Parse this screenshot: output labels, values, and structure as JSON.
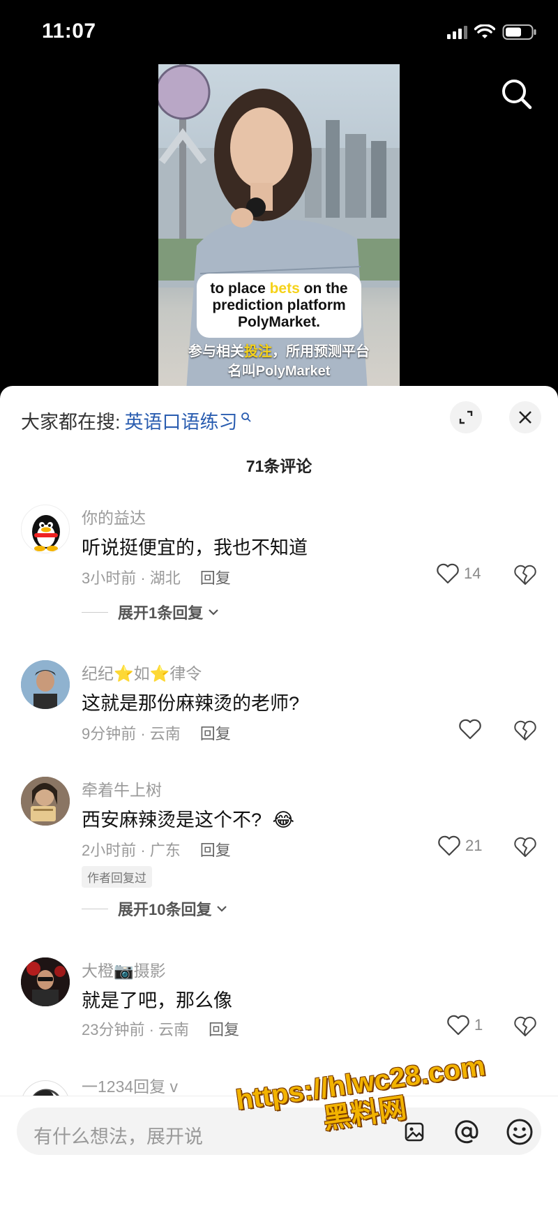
{
  "status_bar": {
    "time": "11:07"
  },
  "video": {
    "subtitle_en_pre": "to place ",
    "subtitle_en_hl": "bets",
    "subtitle_en_post": " on the prediction platform PolyMarket.",
    "subtitle_zh_pre": "参与相关",
    "subtitle_zh_hl": "投注",
    "subtitle_zh_post": "，所用预测平台",
    "subtitle_zh_line2": "名叫PolyMarket"
  },
  "panel": {
    "hot_search_label": "大家都在搜:",
    "hot_search_keyword": "英语口语练习",
    "comment_count": "71条评论"
  },
  "comments": [
    {
      "name": "你的益达",
      "text": "听说挺便宜的，我也不知道",
      "time_location": "3小时前 · 湖北",
      "reply": "回复",
      "likes": "14",
      "expand": "展开1条回复"
    },
    {
      "name": "纪纪⭐如⭐律令",
      "text": "这就是那份麻辣烫的老师?",
      "time_location": "9分钟前 · 云南",
      "reply": "回复",
      "likes": ""
    },
    {
      "name": "牵着牛上树",
      "text": "西安麻辣烫是这个不?",
      "emoji": "😂",
      "time_location": "2小时前 · 广东",
      "reply": "回复",
      "likes": "21",
      "author_tag": "作者回复过",
      "expand": "展开10条回复"
    },
    {
      "name": "大橙📷摄影",
      "text": "就是了吧，那么像",
      "time_location": "23分钟前 · 云南",
      "reply": "回复",
      "likes": "1"
    },
    {
      "name": "一1234回复 v"
    }
  ],
  "input": {
    "placeholder": "有什么想法，展开说"
  },
  "watermark": {
    "line1": "https://hlwc28.com",
    "line2": "黑料网"
  },
  "colors": {
    "accent_link": "#2a5db0",
    "highlight": "#f5d21a",
    "watermark": "#f2b300"
  }
}
